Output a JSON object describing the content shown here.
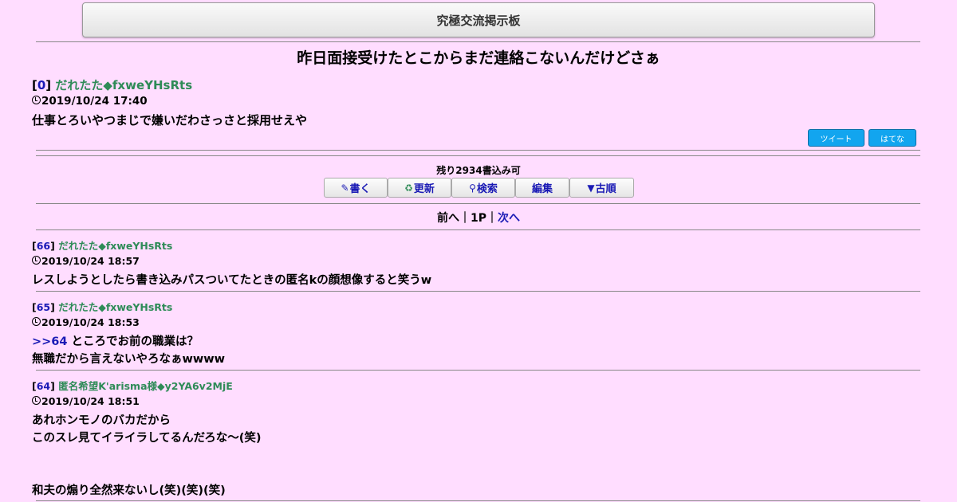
{
  "board": {
    "title": "究極交流掲示板"
  },
  "thread": {
    "title": "昨日面接受けたとこからまだ連絡こないんだけどさぁ",
    "op": {
      "number": "0",
      "author": "だれたた◆fxweYHsRts",
      "datetime": "2019/10/24 17:40",
      "body": "仕事とろいやつまじで嫌いだわさっさと採用せえや"
    }
  },
  "share": {
    "tweet_label": "ツイート",
    "hatena_label": "はてな"
  },
  "status": {
    "remaining": "残り2934書込み可"
  },
  "toolbar": {
    "write_label": "書く",
    "write_icon": "pencil-icon",
    "refresh_label": "更新",
    "refresh_icon": "refresh-icon",
    "search_label": "検索",
    "search_icon": "magnifier-icon",
    "edit_label": "編集",
    "sort_label": "古順",
    "sort_icon": "triangle-down-icon"
  },
  "pager": {
    "prev": "前へ",
    "sep": "｜",
    "current": "1P",
    "next": "次へ"
  },
  "posts": [
    {
      "number": "66",
      "author": "だれたた◆fxweYHsRts",
      "datetime": "2019/10/24 18:57",
      "line1": "レスしようとしたら書き込みパスついてたときの匿名kの顔想像すると笑うw"
    },
    {
      "number": "65",
      "author": "だれたた◆fxweYHsRts",
      "datetime": "2019/10/24 18:53",
      "anchor": ">>64",
      "line1": " ところでお前の職業は？",
      "line2": "無職だから言えないやろなぁwwww"
    },
    {
      "number": "64",
      "author": "匿名希望K'arisma様◆y2YA6v2MjE",
      "datetime": "2019/10/24 18:51",
      "line1": "あれホンモノのバカだから",
      "line2": "このスレ見てイライラしてるんだろな～(笑)",
      "line3": "和夫の煽り全然来ないし(笑)(笑)(笑)"
    }
  ]
}
